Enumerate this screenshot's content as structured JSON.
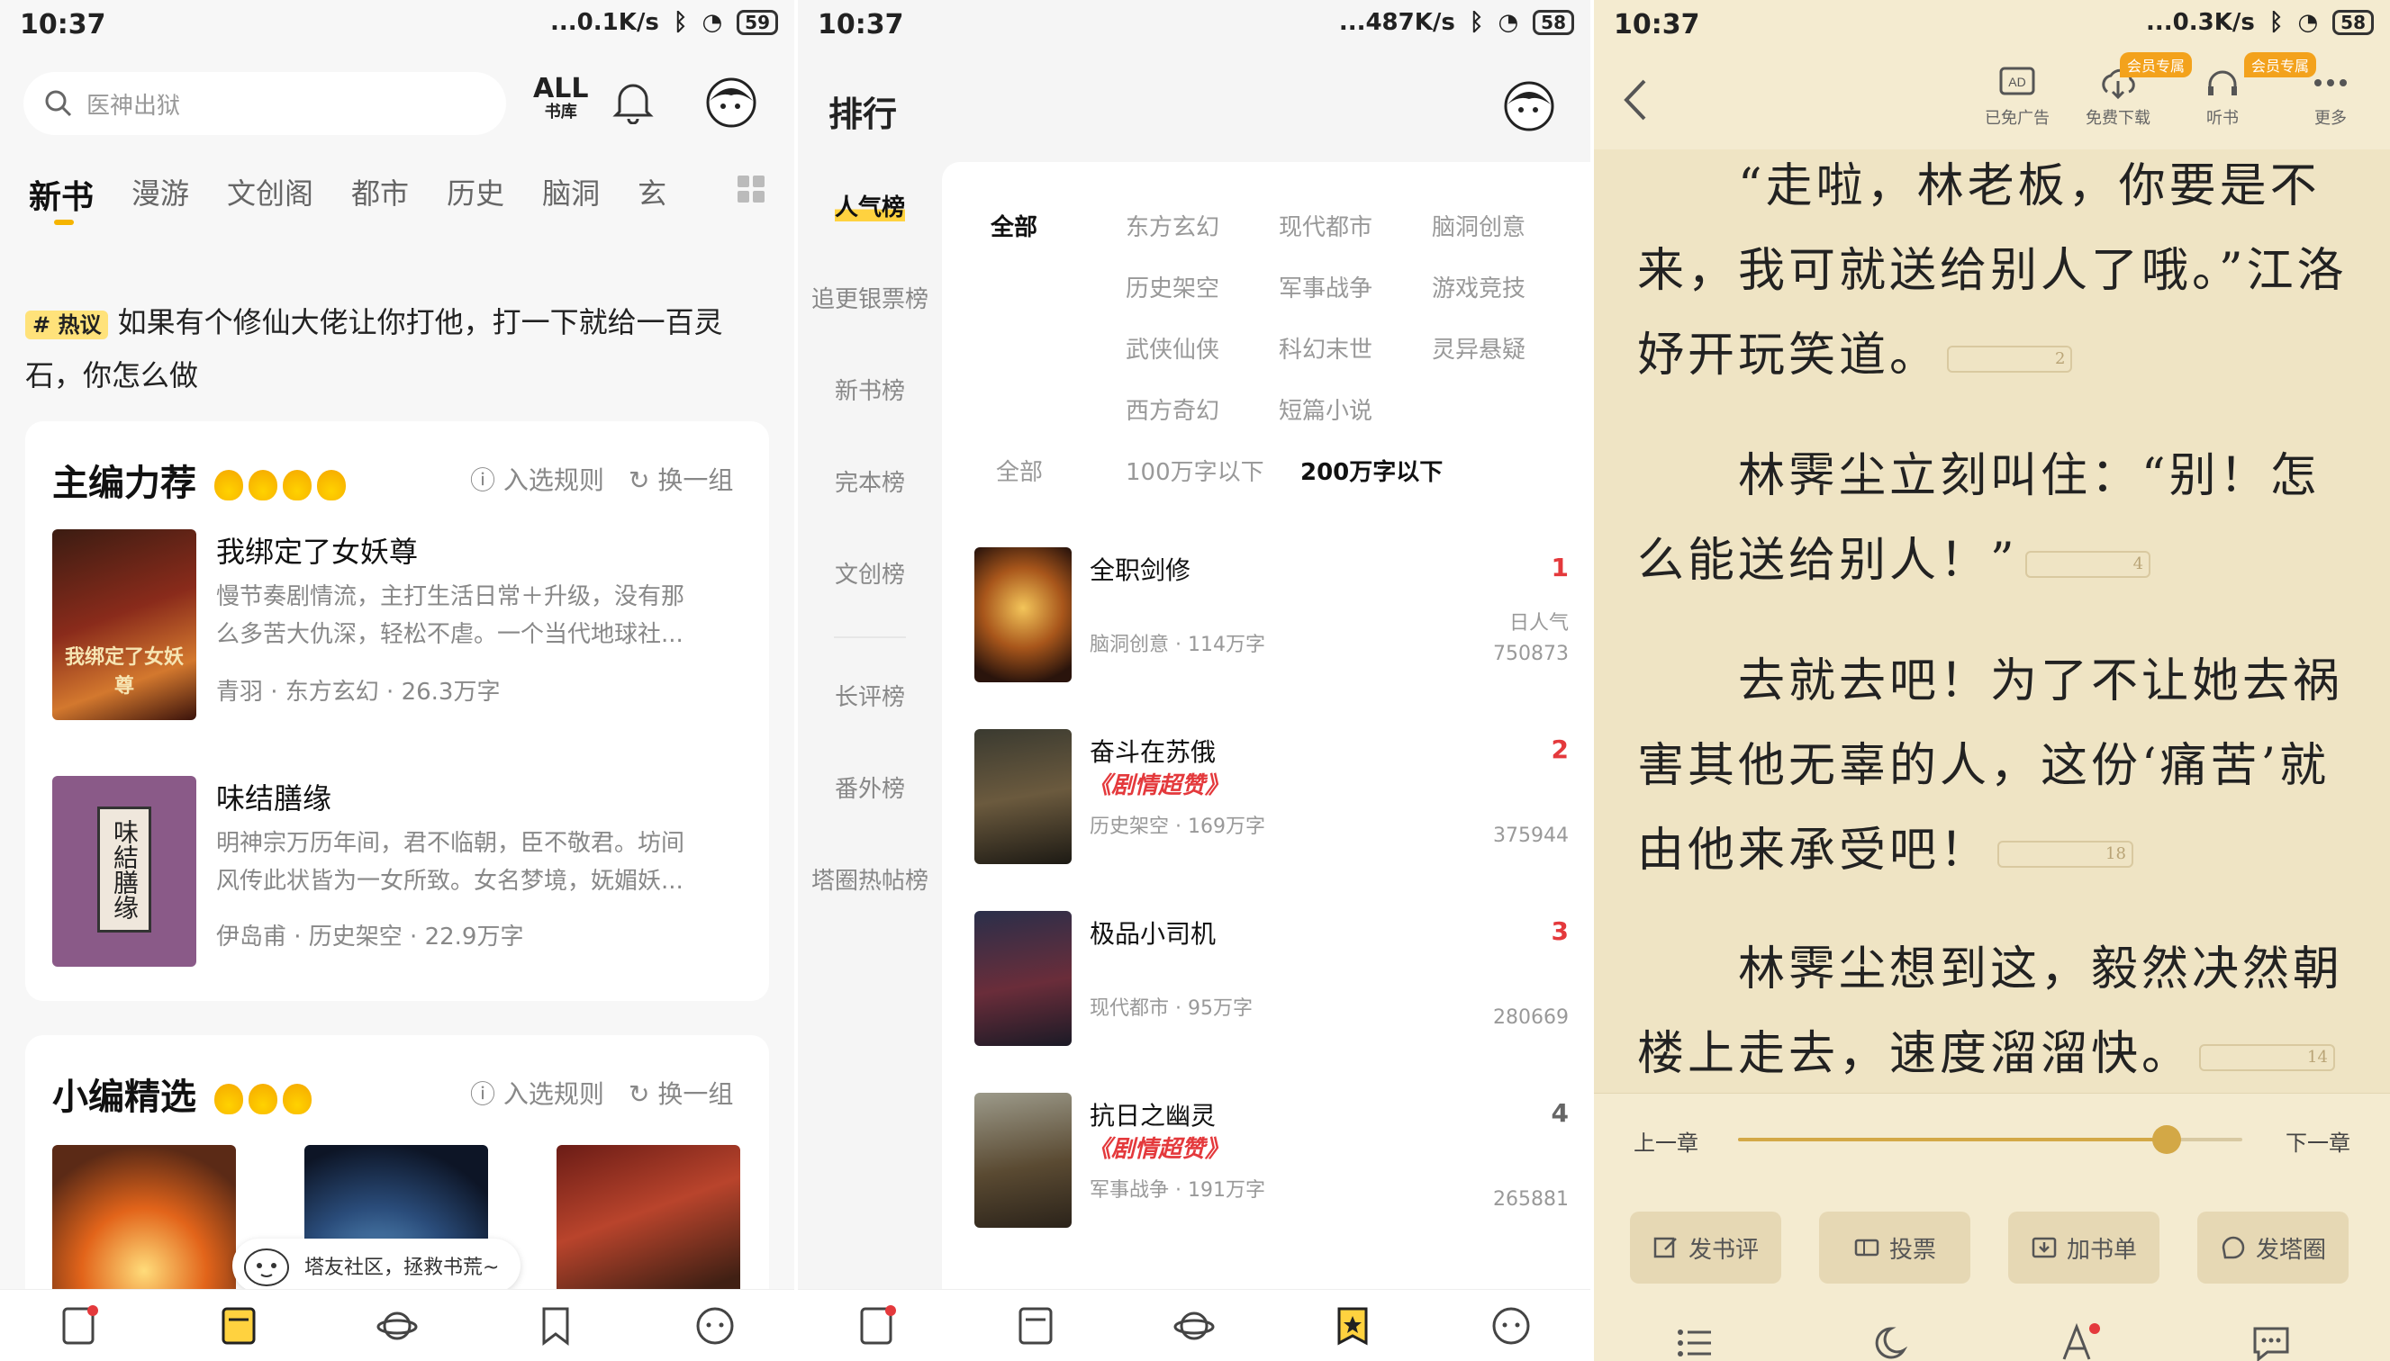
{
  "p1": {
    "status": {
      "time": "10:37",
      "speed": "...0.1K/s",
      "battery": "59"
    },
    "search_placeholder": "医神出狱",
    "library_label": "ALL",
    "library_sub": "书库",
    "tabs": [
      "新书",
      "漫游",
      "文创阁",
      "都市",
      "历史",
      "脑洞",
      "玄"
    ],
    "hot_badge": "热议",
    "hot_text": "如果有个修仙大佬让你打他，打一下就给一百灵石，你怎么做",
    "sec1": {
      "title": "主编力荐",
      "rule": "入选规则",
      "swap": "换一组"
    },
    "books": [
      {
        "title": "我绑定了女妖尊",
        "desc1": "慢节奏剧情流，主打生活日常＋升级，没有那",
        "desc2": "么多苦大仇深，轻松不虐。一个当代地球社...",
        "meta": "青羽 · 东方玄幻 · 26.3万字",
        "cover_text": "我绑定了女妖尊"
      },
      {
        "title": "味结膳缘",
        "desc1": "明神宗万历年间，君不临朝，臣不敬君。坊间",
        "desc2": "风传此状皆为一女所致。女名梦境，妩媚妖...",
        "meta": "伊岛甫 · 历史架空 · 22.9万字",
        "cover_text": "味結膳缘"
      }
    ],
    "sec2": {
      "title": "小编精选",
      "rule": "入选规则",
      "swap": "换一组"
    },
    "community": "塔友社区，拯救书荒~"
  },
  "p2": {
    "status": {
      "time": "10:37",
      "speed": "...487K/s",
      "battery": "58"
    },
    "title": "排行",
    "side": [
      "人气榜",
      "追更银票榜",
      "新书榜",
      "完本榜",
      "文创榜",
      "长评榜",
      "番外榜",
      "塔圈热帖榜"
    ],
    "filters_row1": [
      "全部",
      "东方玄幻",
      "现代都市",
      "脑洞创意"
    ],
    "filters_row2": [
      "历史架空",
      "军事战争",
      "游戏竞技"
    ],
    "filters_row3": [
      "武侠仙侠",
      "科幻末世",
      "灵异悬疑"
    ],
    "filters_row4": [
      "西方奇幻",
      "短篇小说"
    ],
    "words": [
      "全部",
      "100万字以下",
      "200万字以下"
    ],
    "ranks": [
      {
        "title": "全职剑修",
        "tag": "",
        "meta": "脑洞创意 · 114万字",
        "num": "1",
        "label": "日人气",
        "value": "750873"
      },
      {
        "title": "奋斗在苏俄",
        "tag": "《剧情超赞》",
        "meta": "历史架空 · 169万字",
        "num": "2",
        "label": "",
        "value": "375944"
      },
      {
        "title": "极品小司机",
        "tag": "",
        "meta": "现代都市 · 95万字",
        "num": "3",
        "label": "",
        "value": "280669"
      },
      {
        "title": "抗日之幽灵",
        "tag": "《剧情超赞》",
        "meta": "军事战争 · 191万字",
        "num": "4",
        "label": "",
        "value": "265881"
      }
    ]
  },
  "p3": {
    "status": {
      "time": "10:37",
      "speed": "...0.3K/s",
      "battery": "58"
    },
    "top": [
      {
        "label": "已免广告",
        "badge": ""
      },
      {
        "label": "免费下载",
        "badge": "会员专属"
      },
      {
        "label": "听书",
        "badge": "会员专属"
      },
      {
        "label": "更多",
        "badge": ""
      }
    ],
    "paras": [
      {
        "text": "“走啦，林老板，你要是不来，我可就送给别人了哦。”江洛妤开玩笑道。",
        "fn": "2"
      },
      {
        "text": "林霁尘立刻叫住：“别！怎么能送给别人！”",
        "fn": "4"
      },
      {
        "text": "去就去吧！为了不让她去祸害其他无辜的人，这份‘痛苦’就由他来承受吧！",
        "fn": "18"
      },
      {
        "text": "林霁尘想到这，毅然决然朝楼上走去，速度溜溜快。",
        "fn": "14"
      }
    ],
    "prev": "上一章",
    "next": "下一章",
    "progress": 0.85,
    "actions": [
      "发书评",
      "投票",
      "加书单",
      "发塔圈"
    ]
  }
}
